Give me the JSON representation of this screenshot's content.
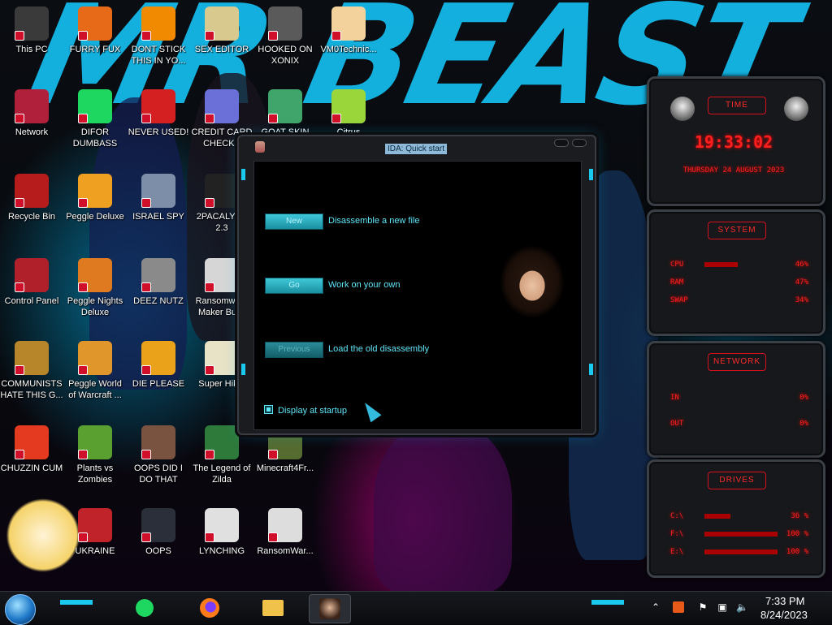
{
  "desktop": {
    "wallpaper_text": "MR BEAST",
    "icons": [
      {
        "label": "This PC",
        "name": "this-pc",
        "x": 0,
        "y": 0,
        "color": "#3a3a3a"
      },
      {
        "label": "FURRY FUX",
        "name": "firefox",
        "x": 1,
        "y": 0,
        "color": "#e76a18"
      },
      {
        "label": "DONT STICK THIS IN YO...",
        "name": "vlc",
        "x": 2,
        "y": 0,
        "color": "#f28a00"
      },
      {
        "label": "SEX EDITOR",
        "name": "hex-editor",
        "x": 3,
        "y": 0,
        "color": "#d8c98f"
      },
      {
        "label": "HOOKED ON XONIX",
        "name": "xonix",
        "x": 4,
        "y": 0,
        "color": "#5a5a5a"
      },
      {
        "label": "VM0Technic...",
        "name": "vm-technician",
        "x": 5,
        "y": 0,
        "color": "#f3d39b"
      },
      {
        "label": "Network",
        "name": "network",
        "x": 0,
        "y": 1,
        "color": "#b0203a"
      },
      {
        "label": "DIFOR DUMBASS",
        "name": "spotify",
        "x": 1,
        "y": 1,
        "color": "#1ed760"
      },
      {
        "label": "NEVER USED!",
        "name": "dev-cpp",
        "x": 2,
        "y": 1,
        "color": "#d42020"
      },
      {
        "label": "CREDIT CARD CHECKE",
        "name": "credit-card-checker",
        "x": 3,
        "y": 1,
        "color": "#6b6fd8"
      },
      {
        "label": "GOAT SKIN",
        "name": "goat-skin",
        "x": 4,
        "y": 1,
        "color": "#3fa56a"
      },
      {
        "label": "Citrus",
        "name": "lime",
        "x": 5,
        "y": 1,
        "color": "#9ad53a"
      },
      {
        "label": "Recycle Bin",
        "name": "recycle-bin",
        "x": 0,
        "y": 2,
        "color": "#b71c1c"
      },
      {
        "label": "Peggle Deluxe",
        "name": "peggle-deluxe",
        "x": 1,
        "y": 2,
        "color": "#f0a020"
      },
      {
        "label": "ISRAEL SPY",
        "name": "israel-spy",
        "x": 2,
        "y": 2,
        "color": "#7c8ea8"
      },
      {
        "label": "2PACALYPS 2.3",
        "name": "tupacalypse",
        "x": 3,
        "y": 2,
        "color": "#222222"
      },
      {
        "label": "Control Panel",
        "name": "control-panel",
        "x": 0,
        "y": 3,
        "color": "#b0202a"
      },
      {
        "label": "Peggle Nights Deluxe",
        "name": "peggle-nights",
        "x": 1,
        "y": 3,
        "color": "#e07a20"
      },
      {
        "label": "DEEZ NUTZ",
        "name": "deez-nutz",
        "x": 2,
        "y": 3,
        "color": "#8a8a8a"
      },
      {
        "label": "Ransomware Maker Build",
        "name": "ransomware-maker",
        "x": 3,
        "y": 3,
        "color": "#d6d6d6"
      },
      {
        "label": "COMMUNISTS HATE THIS G...",
        "name": "dollar-bag",
        "x": 0,
        "y": 4,
        "color": "#b8862a"
      },
      {
        "label": "Peggle World of Warcraft ...",
        "name": "peggle-wow",
        "x": 1,
        "y": 4,
        "color": "#e0962a"
      },
      {
        "label": "DIE PLEASE",
        "name": "die-please",
        "x": 2,
        "y": 4,
        "color": "#e9a21a"
      },
      {
        "label": "Super Hik...",
        "name": "super-hiker",
        "x": 3,
        "y": 4,
        "color": "#e8e2c6"
      },
      {
        "label": "CHUZZIN CUM",
        "name": "chuzzle",
        "x": 0,
        "y": 5,
        "color": "#e43a20"
      },
      {
        "label": "Plants vs Zombies",
        "name": "plants-vs-zombies",
        "x": 1,
        "y": 5,
        "color": "#5aa030"
      },
      {
        "label": "OOPS DID I DO THAT",
        "name": "oops-portrait",
        "x": 2,
        "y": 5,
        "color": "#7a5240"
      },
      {
        "label": "The Legend of Zilda",
        "name": "legend-of-zilda",
        "x": 3,
        "y": 5,
        "color": "#2e7a3a"
      },
      {
        "label": "Minecraft4Fr...",
        "name": "minecraft",
        "x": 4,
        "y": 5,
        "color": "#556b2f"
      },
      {
        "label": "UKRAINE",
        "name": "ukraine-radiation",
        "x": 1,
        "y": 6,
        "color": "#c0242a"
      },
      {
        "label": "OOPS",
        "name": "oops",
        "x": 2,
        "y": 6,
        "color": "#2a2f3a"
      },
      {
        "label": "LYNCHING",
        "name": "lynching",
        "x": 3,
        "y": 6,
        "color": "#e0e0e0"
      },
      {
        "label": "RansomWar...",
        "name": "ransomware-skull",
        "x": 4,
        "y": 6,
        "color": "#dddddd"
      }
    ]
  },
  "ida_dialog": {
    "title": "IDA: Quick start",
    "buttons": [
      {
        "label": "New",
        "desc": "Disassemble a new file",
        "disabled": false
      },
      {
        "label": "Go",
        "desc": "Work on your own",
        "disabled": false
      },
      {
        "label": "Previous",
        "desc": "Load the old disassembly",
        "disabled": true
      }
    ],
    "startup_label": "Display at startup"
  },
  "gadgets": {
    "time": {
      "head": "TIME",
      "clock": "19:33:02",
      "date": "THURSDAY 24 AUGUST 2023"
    },
    "system": {
      "head": "SYSTEM",
      "rows": [
        {
          "key": "CPU",
          "value": "46%",
          "pct": 46
        },
        {
          "key": "RAM",
          "value": "47%",
          "pct": 47
        },
        {
          "key": "SWAP",
          "value": "34%",
          "pct": 34
        }
      ]
    },
    "network": {
      "head": "NETWORK",
      "rows": [
        {
          "key": "IN",
          "value": "0%"
        },
        {
          "key": "OUT",
          "value": "0%"
        }
      ]
    },
    "drives": {
      "head": "DRIVES",
      "rows": [
        {
          "key": "C:\\",
          "value": "36 %",
          "pct": 36
        },
        {
          "key": "F:\\",
          "value": "100 %",
          "pct": 100
        },
        {
          "key": "E:\\",
          "value": "100 %",
          "pct": 100
        }
      ]
    }
  },
  "taskbar": {
    "pinned": [
      "spotify",
      "firefox",
      "file-explorer",
      "ida-portrait"
    ],
    "clock_time": "7:33 PM",
    "clock_date": "8/24/2023",
    "accent": "#19c9ee"
  }
}
